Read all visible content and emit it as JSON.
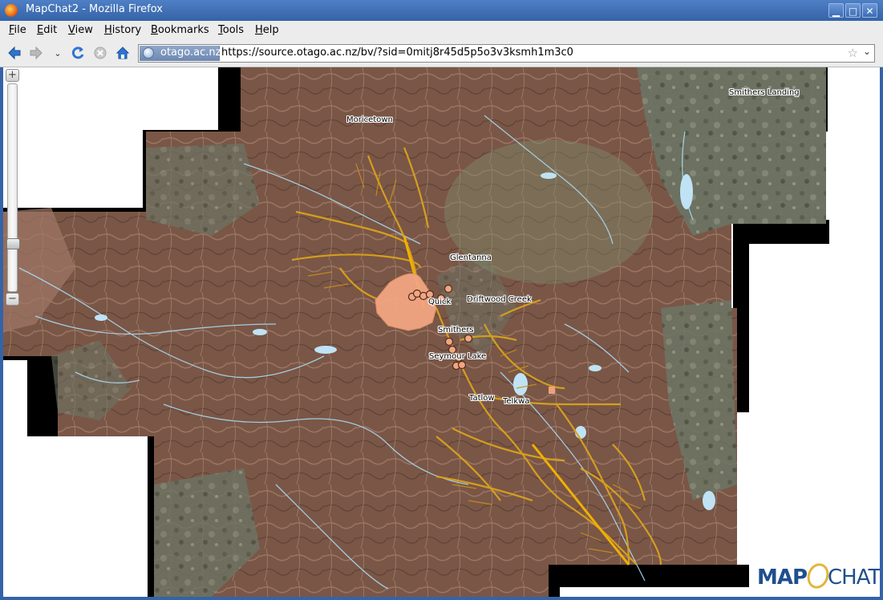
{
  "window": {
    "title": "MapChat2 - Mozilla Firefox",
    "buttons": [
      "minimize",
      "maximize",
      "close"
    ]
  },
  "menubar": {
    "items": [
      {
        "label": "File",
        "underline": "F",
        "rest": "ile"
      },
      {
        "label": "Edit",
        "underline": "E",
        "rest": "dit"
      },
      {
        "label": "View",
        "underline": "V",
        "rest": "iew"
      },
      {
        "label": "History",
        "underline": "H",
        "rest": "istory"
      },
      {
        "label": "Bookmarks",
        "underline": "B",
        "rest": "ookmarks"
      },
      {
        "label": "Tools",
        "underline": "T",
        "rest": "ools"
      },
      {
        "label": "Help",
        "underline": "H",
        "rest": "elp"
      }
    ]
  },
  "navbar": {
    "icons": [
      "back-arrow-icon",
      "forward-arrow-icon",
      "history-dropdown-icon",
      "reload-icon",
      "stop-icon",
      "home-icon"
    ],
    "identity_domain": "otago.ac.nz",
    "url": "https://source.otago.ac.nz/bv/?sid=0mitj8r45d5p5o3v3ksmh1m3c0"
  },
  "map": {
    "places": {
      "smithers_landing": "Smithers Landing",
      "moricetown": "Moricetown",
      "glentanna": "Glentanna",
      "quick": "Quick",
      "driftwood_creek": "Driftwood Creek",
      "smithers": "Smithers",
      "seymour_lake": "Seymour Lake",
      "tatlow": "Tatlow",
      "telkwa": "Telkwa"
    },
    "zoom": {
      "in": "+",
      "out": "−"
    },
    "colors": {
      "terrain": "#7c5a4a",
      "forest": "#6b7560",
      "highlight": "#f2a680",
      "streams": "#d9a21c",
      "water": "#bfe3f5",
      "nodata": "#000000"
    }
  },
  "logo": {
    "part1": "MAP",
    "part2": "CHAT"
  }
}
